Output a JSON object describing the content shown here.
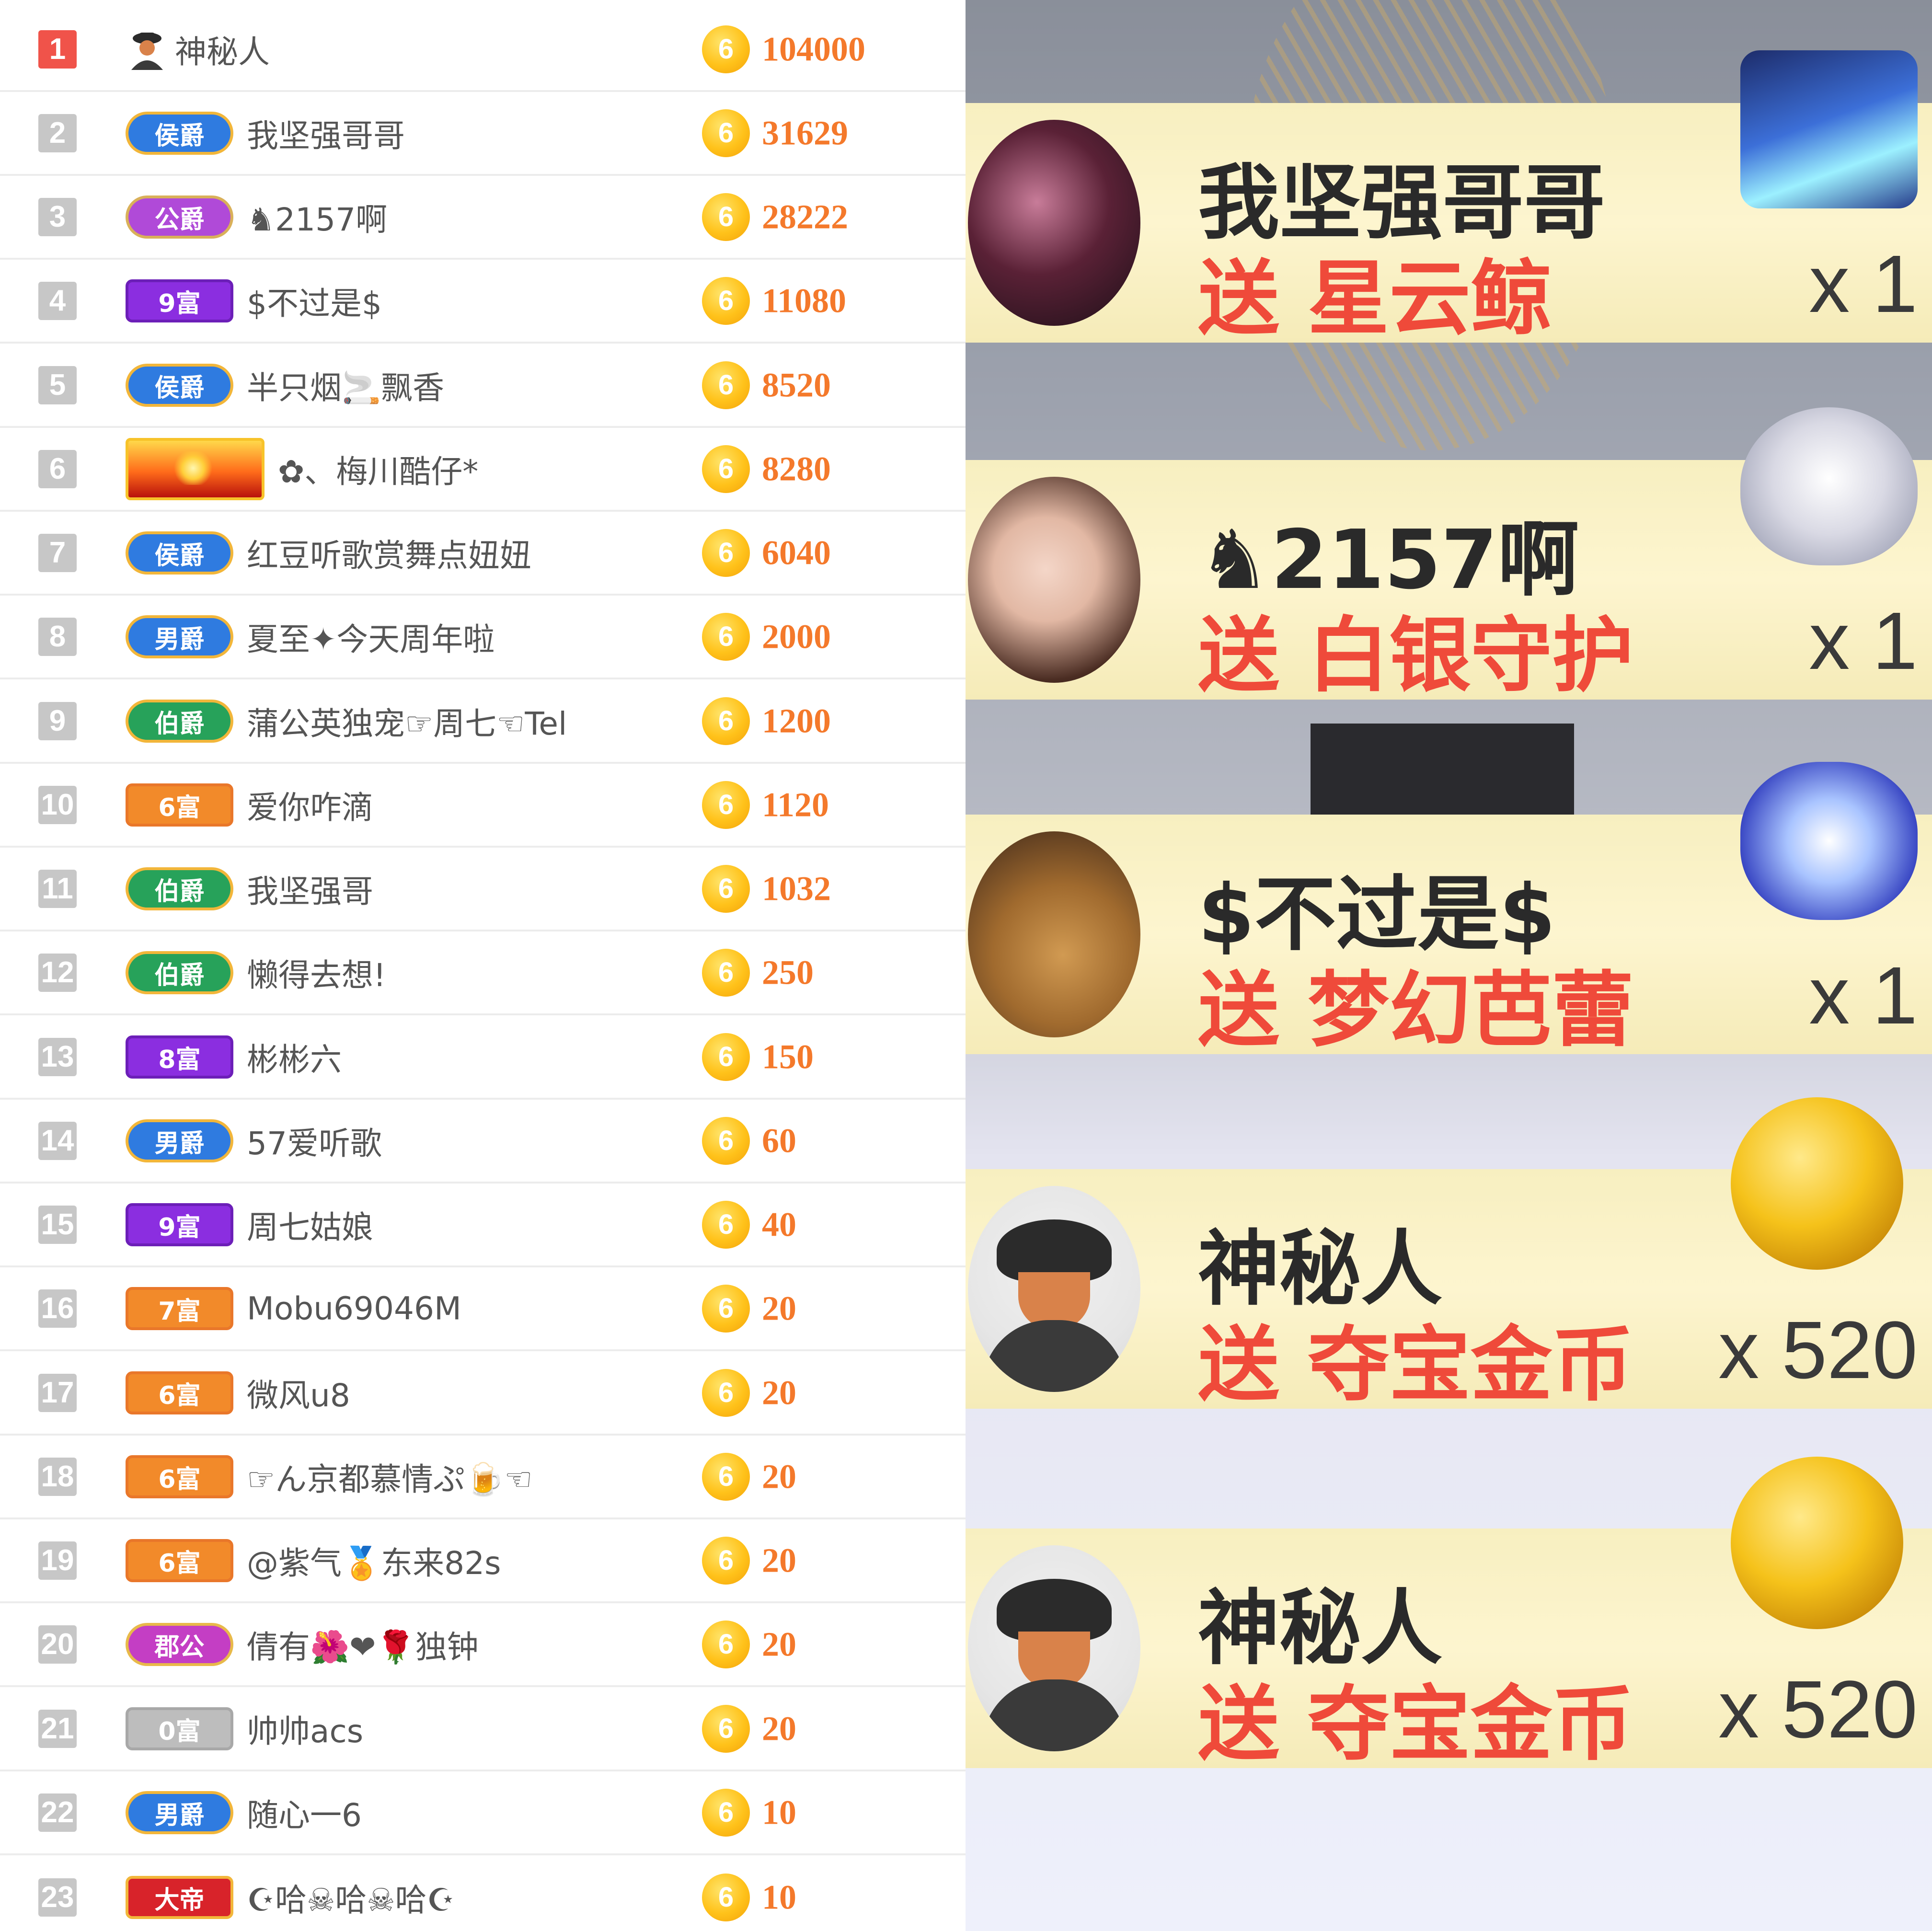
{
  "ranking": {
    "rows": [
      {
        "rank": "1",
        "badge": "",
        "badge_type": "user-icon",
        "name": "神秘人",
        "coin": "6",
        "amount": "104000"
      },
      {
        "rank": "2",
        "badge": "侯爵",
        "badge_type": "blue",
        "name": "我坚强哥哥",
        "coin": "6",
        "amount": "31629"
      },
      {
        "rank": "3",
        "badge": "公爵",
        "badge_type": "purple",
        "name": "♞2157啊",
        "coin": "6",
        "amount": "28222"
      },
      {
        "rank": "4",
        "badge": "9富",
        "badge_type": "violet",
        "name": "$不过是$",
        "coin": "6",
        "amount": "11080"
      },
      {
        "rank": "5",
        "badge": "侯爵",
        "badge_type": "blue",
        "name": "半只烟🚬飘香",
        "coin": "6",
        "amount": "8520"
      },
      {
        "rank": "6",
        "badge": "",
        "badge_type": "crown",
        "name": "✿、梅川酷仔*",
        "coin": "6",
        "amount": "8280"
      },
      {
        "rank": "7",
        "badge": "侯爵",
        "badge_type": "blue",
        "name": "红豆听歌赏舞点妞妞",
        "coin": "6",
        "amount": "6040"
      },
      {
        "rank": "8",
        "badge": "男爵",
        "badge_type": "blue",
        "name": "夏至✦今天周年啦",
        "coin": "6",
        "amount": "2000"
      },
      {
        "rank": "9",
        "badge": "伯爵",
        "badge_type": "green",
        "name": "蒲公英独宠☞周七☜Tel",
        "coin": "6",
        "amount": "1200"
      },
      {
        "rank": "10",
        "badge": "6富",
        "badge_type": "orange",
        "name": "爱你咋滴",
        "coin": "6",
        "amount": "1120"
      },
      {
        "rank": "11",
        "badge": "伯爵",
        "badge_type": "green",
        "name": "我坚强哥",
        "coin": "6",
        "amount": "1032"
      },
      {
        "rank": "12",
        "badge": "伯爵",
        "badge_type": "green",
        "name": "懒得去想!",
        "coin": "6",
        "amount": "250"
      },
      {
        "rank": "13",
        "badge": "8富",
        "badge_type": "violet",
        "name": "彬彬六",
        "coin": "6",
        "amount": "150"
      },
      {
        "rank": "14",
        "badge": "男爵",
        "badge_type": "blue",
        "name": "57爱听歌",
        "coin": "6",
        "amount": "60"
      },
      {
        "rank": "15",
        "badge": "9富",
        "badge_type": "violet",
        "name": "周七姑娘",
        "coin": "6",
        "amount": "40"
      },
      {
        "rank": "16",
        "badge": "7富",
        "badge_type": "orange",
        "name": "Mobu69046M",
        "coin": "6",
        "amount": "20"
      },
      {
        "rank": "17",
        "badge": "6富",
        "badge_type": "orange",
        "name": "微风u8",
        "coin": "6",
        "amount": "20"
      },
      {
        "rank": "18",
        "badge": "6富",
        "badge_type": "orange",
        "name": "☞ん京都慕情ぷ🍺☜",
        "coin": "6",
        "amount": "20"
      },
      {
        "rank": "19",
        "badge": "6富",
        "badge_type": "orange",
        "name": "@紫气🏅东来82s",
        "coin": "6",
        "amount": "20"
      },
      {
        "rank": "20",
        "badge": "郡公",
        "badge_type": "magenta",
        "name": "倩有🌺❤🌹独钟",
        "coin": "6",
        "amount": "20"
      },
      {
        "rank": "21",
        "badge": "0富",
        "badge_type": "gray",
        "name": "帅帅acs",
        "coin": "6",
        "amount": "20"
      },
      {
        "rank": "22",
        "badge": "男爵",
        "badge_type": "blue",
        "name": "随心一6",
        "coin": "6",
        "amount": "10"
      },
      {
        "rank": "23",
        "badge": "大帝",
        "badge_type": "red",
        "name": "☪哈☠哈☠哈☪",
        "coin": "6",
        "amount": "10"
      }
    ]
  },
  "gift_feed": {
    "items": [
      {
        "sender": "我坚强哥哥",
        "gift": "送 星云鲸",
        "count": "x 1",
        "gift_icon": "whale-gift-icon"
      },
      {
        "sender": "♞2157啊",
        "gift": "送 白银守护",
        "count": "x 1",
        "gift_icon": "shield-gift-icon"
      },
      {
        "sender": "$不过是$",
        "gift": "送 梦幻芭蕾",
        "count": "x 1",
        "gift_icon": "ballet-gift-icon"
      },
      {
        "sender": "神秘人",
        "gift": "送 夺宝金币",
        "count": "x 520",
        "gift_icon": "gold-coin-icon"
      },
      {
        "sender": "神秘人",
        "gift": "送 夺宝金币",
        "count": "x 520",
        "gift_icon": "gold-coin-icon"
      }
    ]
  },
  "colors": {
    "rank_top": "#f0534a",
    "rank_default": "#c7c7c7",
    "amount": "#f4792b",
    "gift_text": "#ef4a3a",
    "gift_band": "#fdf5cf"
  }
}
